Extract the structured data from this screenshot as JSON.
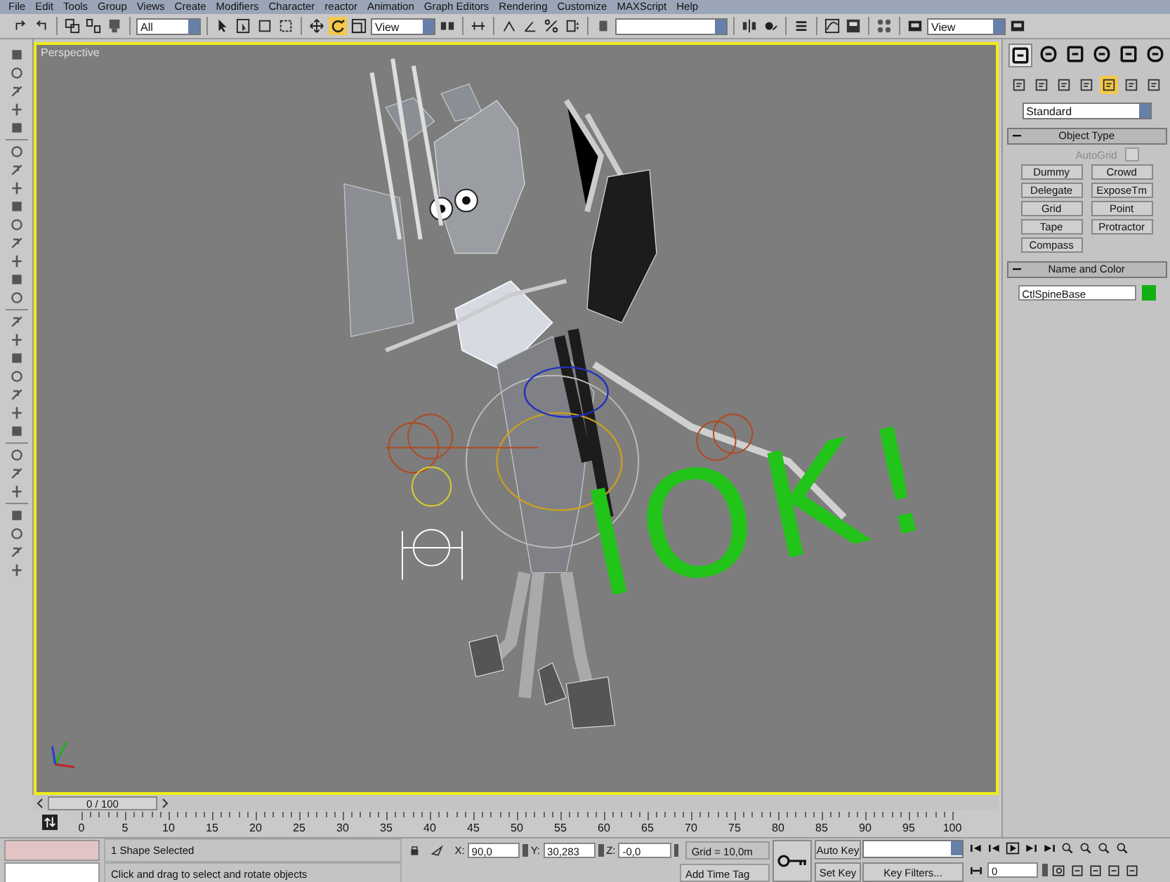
{
  "menu": [
    "File",
    "Edit",
    "Tools",
    "Group",
    "Views",
    "Create",
    "Modifiers",
    "Character",
    "reactor",
    "Animation",
    "Graph Editors",
    "Rendering",
    "Customize",
    "MAXScript",
    "Help"
  ],
  "toolbar": {
    "selection_filter": "All",
    "tools": [
      {
        "selected": false
      },
      {
        "selected": false
      },
      {
        "selected": true
      },
      {
        "selected": false
      }
    ],
    "reference_coordinate": "View",
    "render_type": "View"
  },
  "viewport": {
    "label": "Perspective",
    "annotation": "IOK!"
  },
  "command_panel": {
    "tabs": [
      {
        "selected": true
      },
      {
        "selected": false
      },
      {
        "selected": false
      },
      {
        "selected": false
      },
      {
        "selected": false
      },
      {
        "selected": false
      }
    ],
    "categories": [
      {
        "selected": false
      },
      {
        "selected": false
      },
      {
        "selected": false
      },
      {
        "selected": false
      },
      {
        "selected": true
      },
      {
        "selected": false
      },
      {
        "selected": false
      }
    ],
    "type_dropdown": "Standard",
    "object_type": {
      "title": "Object Type",
      "autogrid": {
        "label": "AutoGrid",
        "checked": false,
        "disabled": true
      },
      "buttons": [
        "Dummy",
        "Crowd",
        "Delegate",
        "ExposeTm",
        "Grid",
        "Point",
        "Tape",
        "Protractor",
        "Compass"
      ]
    },
    "name_and_color": {
      "title": "Name and Color",
      "name": "CtlSpineBase",
      "color": "#12b012"
    }
  },
  "time_slider": {
    "label": "0 / 100",
    "level": 0
  },
  "track_bar": {
    "ticks": [
      "0",
      "5",
      "10",
      "15",
      "20",
      "25",
      "30",
      "35",
      "40",
      "45",
      "50",
      "55",
      "60",
      "65",
      "70",
      "75",
      "80",
      "85",
      "90",
      "95",
      "100"
    ]
  },
  "status": {
    "selection": "1 Shape Selected",
    "prompt": "Click and drag to select and rotate objects",
    "coords": [
      {
        "label": "X:",
        "value": "90,0"
      },
      {
        "label": "Y:",
        "value": "30,283"
      },
      {
        "label": "Z:",
        "value": "-0,0"
      }
    ],
    "grid": "Grid = 10,0m",
    "time_tag": "Add Time Tag",
    "auto_key": {
      "label": "Auto Key",
      "on": false
    },
    "set_key": "Set Key",
    "key_filters": "Key Filters...",
    "frame": "0"
  }
}
